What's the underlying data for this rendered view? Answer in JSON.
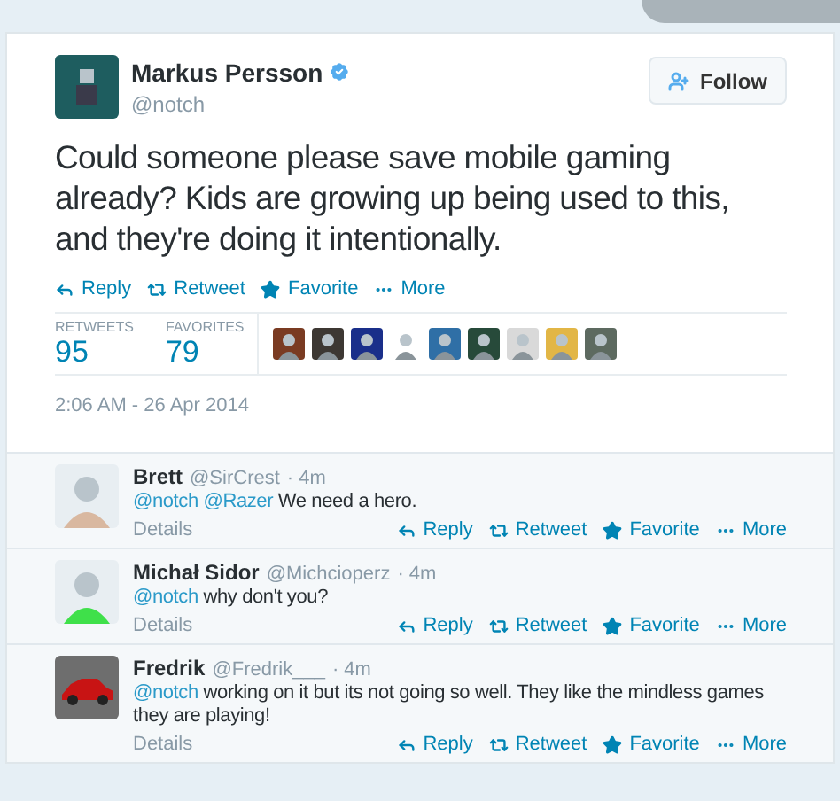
{
  "tweet": {
    "author": {
      "name": "Markus Persson",
      "handle": "@notch",
      "verified": true
    },
    "follow_button": "Follow",
    "text": "Could someone please save mobile gaming already? Kids are growing up being used to this, and they're doing it intentionally.",
    "actions": [
      "Reply",
      "Retweet",
      "Favorite",
      "More"
    ],
    "stats": [
      {
        "label": "RETWEETS",
        "value": "95"
      },
      {
        "label": "FAVORITES",
        "value": "79"
      }
    ],
    "favoriters": [
      {
        "color": "#7a3b22"
      },
      {
        "color": "#3d3833"
      },
      {
        "color": "#1a2f8a"
      },
      {
        "color": "#ffffff"
      },
      {
        "color": "#2f6fa6"
      },
      {
        "color": "#274a3a"
      },
      {
        "color": "#d9d9d9"
      },
      {
        "color": "#e2b646"
      },
      {
        "color": "#5d6a60"
      }
    ],
    "timestamp": "2:06 AM - 26 Apr 2014"
  },
  "replies": [
    {
      "name": "Brett",
      "handle": "@SirCrest",
      "time": "· 4m",
      "avatar": {
        "kind": "person"
      },
      "mentions": [
        "@notch",
        "@Razer"
      ],
      "text": "We need a hero.",
      "details": "Details",
      "actions": [
        "Reply",
        "Retweet",
        "Favorite",
        "More"
      ]
    },
    {
      "name": "Michał Sidor",
      "handle": "@Michcioperz",
      "time": "· 4m",
      "avatar": {
        "kind": "person"
      },
      "mentions": [
        "@notch"
      ],
      "text": "why don't you?",
      "details": "Details",
      "actions": [
        "Reply",
        "Retweet",
        "Favorite",
        "More"
      ]
    },
    {
      "name": "Fredrik",
      "handle": "@Fredrik___",
      "time": "· 4m",
      "avatar": {
        "kind": "car"
      },
      "mentions": [
        "@notch"
      ],
      "text": "working on it but its not going so well. They like the mindless games they are playing!",
      "details": "Details",
      "actions": [
        "Reply",
        "Retweet",
        "Favorite",
        "More"
      ]
    }
  ]
}
